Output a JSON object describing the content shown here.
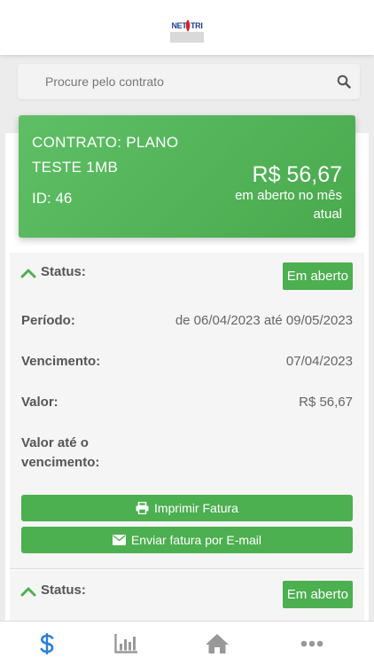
{
  "header": {
    "logo_left": "NET",
    "logo_right": "TRI"
  },
  "search": {
    "placeholder": "Procure pelo contrato",
    "icon": "search-icon"
  },
  "contract": {
    "title": "CONTRATO: PLANO TESTE 1MB",
    "id_text": "ID: 46",
    "amount": "R$ 56,67",
    "amount_caption": "em aberto no mês atual"
  },
  "invoices": [
    {
      "status_label": "Status:",
      "status_value": "Em aberto",
      "periodo_label": "Período:",
      "periodo_value": "de 06/04/2023 até 09/05/2023",
      "vencimento_label": "Vencimento:",
      "vencimento_value": "07/04/2023",
      "valor_label": "Valor:",
      "valor_value": "R$ 56,67",
      "valor_ate_label": "Valor até o vencimento:",
      "print_button": "Imprimir Fatura",
      "email_button": "Enviar fatura por E-mail"
    },
    {
      "status_label": "Status:",
      "status_value": "Em aberto"
    }
  ],
  "tabbar": {
    "items": [
      "dollar-icon",
      "bar-chart-icon",
      "home-icon",
      "more-icon"
    ],
    "active_color": "#2a7fd4",
    "inactive_color": "#999999"
  },
  "colors": {
    "accent": "#4caf50"
  }
}
